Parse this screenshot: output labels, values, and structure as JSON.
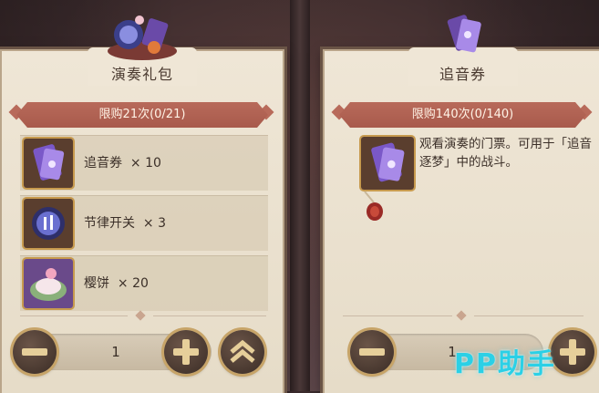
{
  "left_card": {
    "title": "演奏礼包",
    "limit": "限购21次(0/21)",
    "items": [
      {
        "name": "追音券",
        "qty": "× 10",
        "icon": "ticket-icon"
      },
      {
        "name": "节律开关",
        "qty": "× 3",
        "icon": "rhythm-switch-icon"
      },
      {
        "name": "樱饼",
        "qty": "× 20",
        "icon": "sakura-mochi-icon"
      }
    ],
    "quantity": "1"
  },
  "right_card": {
    "title": "追音券",
    "limit": "限购140次(0/140)",
    "description": "观看演奏的门票。可用于「追音逐梦」中的战斗。",
    "quantity": "1"
  },
  "watermark": "PP助手",
  "colors": {
    "accent": "#b86a5a",
    "gold": "#c7a468",
    "panel": "#efe6d6"
  }
}
